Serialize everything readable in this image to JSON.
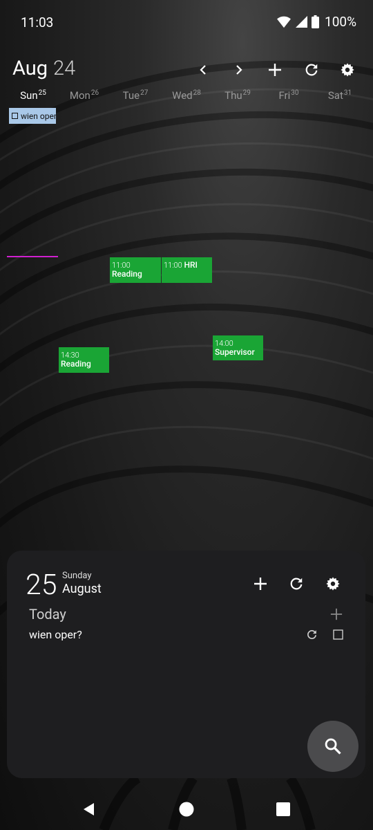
{
  "status_bar": {
    "time": "11:03",
    "battery": "100%"
  },
  "header": {
    "month": "Aug",
    "year": "24"
  },
  "days": [
    {
      "name": "Sun",
      "num": "25"
    },
    {
      "name": "Mon",
      "num": "26"
    },
    {
      "name": "Tue",
      "num": "27"
    },
    {
      "name": "Wed",
      "num": "28"
    },
    {
      "name": "Thu",
      "num": "29"
    },
    {
      "name": "Fri",
      "num": "30"
    },
    {
      "name": "Sat",
      "num": "31"
    }
  ],
  "allday_event": {
    "title": "wien oper"
  },
  "events": [
    {
      "time": "11:00",
      "title": "Reading"
    },
    {
      "time": "11:00",
      "title": "HRI"
    },
    {
      "time": "14:30",
      "title": "Reading"
    },
    {
      "time": "14:00",
      "title": "Supervisor"
    }
  ],
  "widget": {
    "day_number": "25",
    "weekday": "Sunday",
    "month": "August",
    "section_label": "Today",
    "items": [
      {
        "title": "wien oper?"
      }
    ]
  },
  "colors": {
    "event_green": "#1aa535",
    "allday_blue": "#a9c8e8",
    "now_line": "#d020d0",
    "widget_bg": "#1e1e20"
  },
  "icons": [
    "wifi-icon",
    "signal-icon",
    "battery-icon",
    "chevron-left-icon",
    "chevron-right-icon",
    "plus-icon",
    "refresh-icon",
    "gear-icon",
    "search-icon",
    "back-icon",
    "home-icon",
    "recents-icon"
  ]
}
